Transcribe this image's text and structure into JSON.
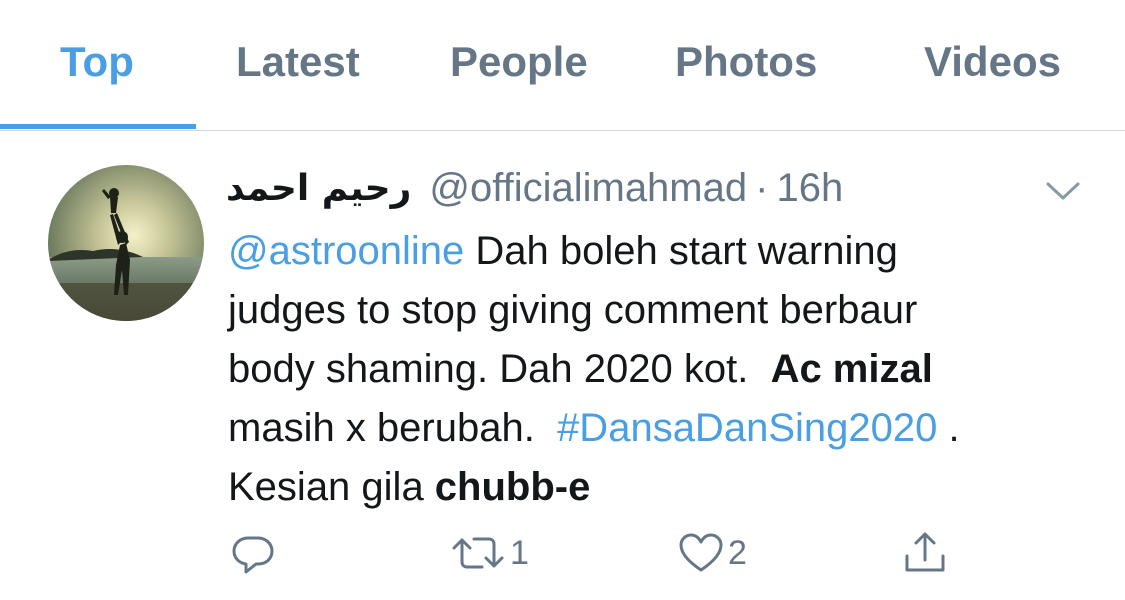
{
  "tabs": [
    {
      "label": "Top",
      "active": true
    },
    {
      "label": "Latest",
      "active": false
    },
    {
      "label": "People",
      "active": false
    },
    {
      "label": "Photos",
      "active": false
    },
    {
      "label": "Videos",
      "active": false
    }
  ],
  "tweet": {
    "display_name": "رحيم احمد",
    "handle": "@officialimahmad",
    "separator": "·",
    "time": "16h",
    "body": {
      "mention": "@astroonline",
      "text_1": " Dah boleh start warning",
      "text_2": "judges to stop giving comment berbaur",
      "text_3": "body shaming. Dah 2020 kot.  ",
      "bold_1": "Ac mizal",
      "text_4": "masih x berubah.  ",
      "hashtag": "#DansaDanSing2020",
      "text_5": " .",
      "text_6": "Kesian gila ",
      "bold_2": "chubb-e"
    },
    "actions": {
      "reply_count": "",
      "retweet_count": "1",
      "like_count": "2"
    }
  },
  "colors": {
    "accent": "#4a9ee3",
    "secondary_text": "#657786",
    "primary_text": "#14171a",
    "divider": "#cfd6dc"
  },
  "icons": [
    "chevron-down-icon",
    "reply-icon",
    "retweet-icon",
    "like-icon",
    "share-icon"
  ]
}
